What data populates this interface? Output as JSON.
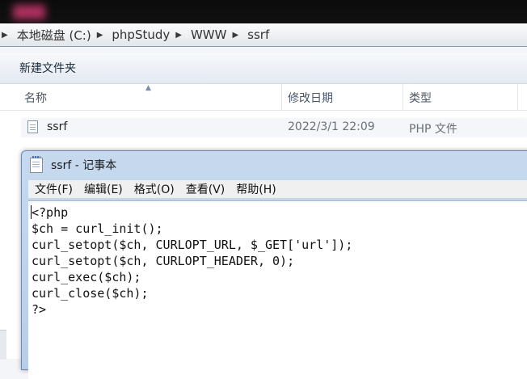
{
  "explorer": {
    "breadcrumb": [
      "本地磁盘 (C:)",
      "phpStudy",
      "WWW",
      "ssrf"
    ],
    "toolbar": {
      "new_folder_label": "新建文件夹"
    },
    "columns": {
      "name": "名称",
      "modified": "修改日期",
      "type": "类型"
    },
    "files": [
      {
        "name": "ssrf",
        "modified": "2022/3/1 22:09",
        "type": "PHP 文件"
      }
    ]
  },
  "notepad": {
    "title": "ssrf - 记事本",
    "menus": [
      "文件(F)",
      "编辑(E)",
      "格式(O)",
      "查看(V)",
      "帮助(H)"
    ],
    "content": "<?php\n$ch = curl_init();\ncurl_setopt($ch, CURLOPT_URL, $_GET['url']);\ncurl_setopt($ch, CURLOPT_HEADER, 0);\ncurl_exec($ch);\ncurl_close($ch);\n?>"
  },
  "icons": {
    "breadcrumb_separator": "triangle-right-icon",
    "file": "php-file-icon",
    "notepad": "notepad-icon"
  }
}
